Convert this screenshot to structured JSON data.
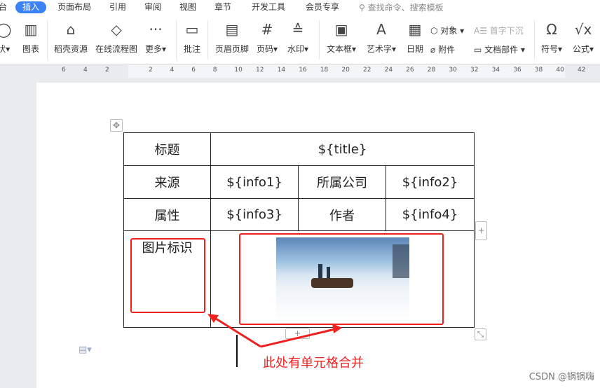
{
  "tabs": [
    {
      "label": "台"
    },
    {
      "label": "插入",
      "active": true
    },
    {
      "label": "页面布局"
    },
    {
      "label": "引用"
    },
    {
      "label": "审阅"
    },
    {
      "label": "视图"
    },
    {
      "label": "章节"
    },
    {
      "label": "开发工具"
    },
    {
      "label": "会员专享"
    }
  ],
  "search_placeholder": "查找命令、搜索模板",
  "toolbar": {
    "shape": "状",
    "chart": "图表",
    "docer": "稻壳资源",
    "flowchart": "在线流程图",
    "more": "更多",
    "comment": "批注",
    "header_footer": "页眉页脚",
    "page_number": "页码",
    "watermark": "水印",
    "textbox": "文本框",
    "wordart": "艺术字",
    "date": "日期",
    "object": "对象",
    "attachment": "附件",
    "dropcap": "首字下沉",
    "doc_parts": "文档部件",
    "symbol": "符号",
    "formula": "公式"
  },
  "ruler_labels": [
    "6",
    "4",
    "2",
    "2",
    "4",
    "6",
    "8",
    "10",
    "12",
    "14",
    "16",
    "18",
    "20",
    "22",
    "24",
    "26",
    "28",
    "30",
    "32",
    "34",
    "36",
    "38",
    "40",
    "42"
  ],
  "table": {
    "r1": [
      "标题",
      "${title}"
    ],
    "r2": [
      "来源",
      "${info1}",
      "所属公司",
      "${info2}"
    ],
    "r3": [
      "属性",
      "${info3}",
      "作者",
      "${info4}"
    ],
    "r4": [
      "图片标识"
    ]
  },
  "annotation": "此处有单元格合并",
  "watermark": "CSDN @锅锅嗨",
  "colors": {
    "accent": "#3b82f6",
    "annotation": "#f02020"
  }
}
